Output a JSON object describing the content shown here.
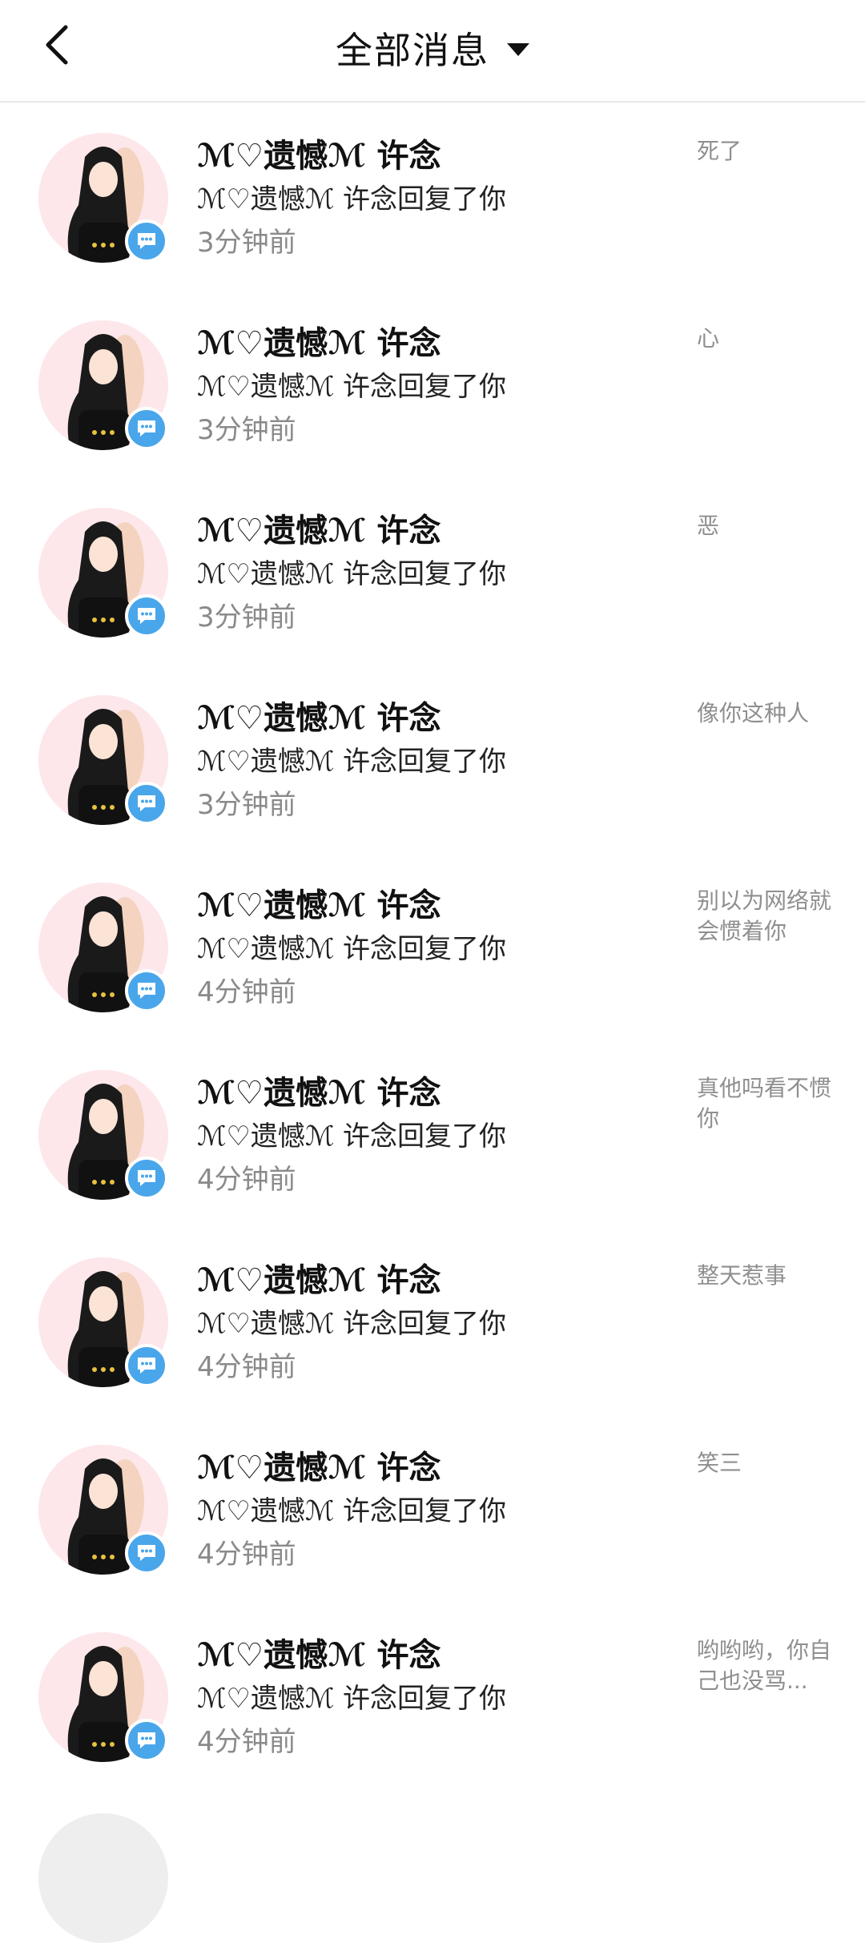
{
  "header": {
    "title": "全部消息",
    "back_icon": "chevron-left-icon",
    "dropdown_icon": "caret-down-icon"
  },
  "colors": {
    "badge": "#4aa6ea",
    "avatar_bg": "#fde7ea",
    "secondary_text": "#8a8a8a"
  },
  "messages": [
    {
      "name": "ℳ♡遗憾ℳ 许念",
      "action": "ℳ♡遗憾ℳ 许念回复了你",
      "time": "3分钟前",
      "preview": "死了"
    },
    {
      "name": "ℳ♡遗憾ℳ 许念",
      "action": "ℳ♡遗憾ℳ 许念回复了你",
      "time": "3分钟前",
      "preview": "心"
    },
    {
      "name": "ℳ♡遗憾ℳ 许念",
      "action": "ℳ♡遗憾ℳ 许念回复了你",
      "time": "3分钟前",
      "preview": "恶"
    },
    {
      "name": "ℳ♡遗憾ℳ 许念",
      "action": "ℳ♡遗憾ℳ 许念回复了你",
      "time": "3分钟前",
      "preview": "像你这种人"
    },
    {
      "name": "ℳ♡遗憾ℳ 许念",
      "action": "ℳ♡遗憾ℳ 许念回复了你",
      "time": "4分钟前",
      "preview": "别以为网络就会惯着你"
    },
    {
      "name": "ℳ♡遗憾ℳ 许念",
      "action": "ℳ♡遗憾ℳ 许念回复了你",
      "time": "4分钟前",
      "preview": "真他吗看不惯你"
    },
    {
      "name": "ℳ♡遗憾ℳ 许念",
      "action": "ℳ♡遗憾ℳ 许念回复了你",
      "time": "4分钟前",
      "preview": "整天惹事"
    },
    {
      "name": "ℳ♡遗憾ℳ 许念",
      "action": "ℳ♡遗憾ℳ 许念回复了你",
      "time": "4分钟前",
      "preview": "笑三"
    },
    {
      "name": "ℳ♡遗憾ℳ 许念",
      "action": "ℳ♡遗憾ℳ 许念回复了你",
      "time": "4分钟前",
      "preview": "哟哟哟，你自己也没骂..."
    }
  ]
}
